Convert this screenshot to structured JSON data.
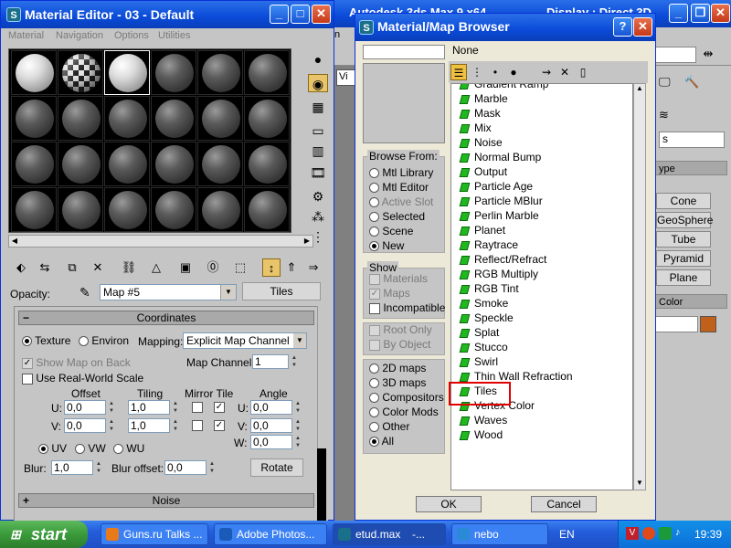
{
  "bg_window": {
    "title": "Autodesk 3ds Max 9 x64",
    "title_right": "Display : Direct 3D",
    "viewport_label": "Vi",
    "menu_fragment": "n",
    "objects": [
      "Cone",
      "GeoSphere",
      "Tube",
      "Pyramid",
      "Plane"
    ],
    "section_type": "ype",
    "section_color": "Color",
    "dropdown_frag": "s",
    "color_swatch": "#c0601a"
  },
  "material_editor": {
    "title": "Material Editor - 03 - Default",
    "menu": [
      "Material",
      "Navigation",
      "Options",
      "Utilities"
    ],
    "opacity_label": "Opacity:",
    "map_name": "Map #5",
    "map_type_button": "Tiles",
    "coordinates": {
      "header": "Coordinates",
      "texture": "Texture",
      "environ": "Environ",
      "mapping_label": "Mapping:",
      "mapping_value": "Explicit Map Channel",
      "show_map_on_back": "Show Map on Back",
      "map_channel_label": "Map Channel:",
      "map_channel_value": "1",
      "use_real_world": "Use Real-World Scale",
      "offset_label": "Offset",
      "tiling_label": "Tiling",
      "mirror_tile_label": "Mirror Tile",
      "angle_label": "Angle",
      "u_label": "U:",
      "v_label": "V:",
      "w_label": "W:",
      "u_offset": "0,0",
      "v_offset": "0,0",
      "u_tiling": "1,0",
      "v_tiling": "1,0",
      "u_angle": "0,0",
      "v_angle": "0,0",
      "w_angle": "0,0",
      "uv": "UV",
      "vw": "VW",
      "wu": "WU",
      "blur_label": "Blur:",
      "blur_value": "1,0",
      "blur_offset_label": "Blur offset:",
      "blur_offset_value": "0,0",
      "rotate_button": "Rotate"
    },
    "noise_header": "Noise"
  },
  "map_browser": {
    "title": "Material/Map Browser",
    "none_label": "None",
    "browse_from": {
      "title": "Browse From:",
      "options": [
        "Mtl Library",
        "Mtl Editor",
        "Active Slot",
        "Selected",
        "Scene",
        "New"
      ]
    },
    "show": {
      "title": "Show",
      "options": [
        "Materials",
        "Maps",
        "Incompatible"
      ]
    },
    "filters": [
      "Root Only",
      "By Object"
    ],
    "categories": [
      "2D maps",
      "3D maps",
      "Compositors",
      "Color Mods",
      "Other",
      "All"
    ],
    "list_items": [
      "Gradient Ramp",
      "Marble",
      "Mask",
      "Mix",
      "Noise",
      "Normal Bump",
      "Output",
      "Particle Age",
      "Particle MBlur",
      "Perlin Marble",
      "Planet",
      "Raytrace",
      "Reflect/Refract",
      "RGB Multiply",
      "RGB Tint",
      "Smoke",
      "Speckle",
      "Splat",
      "Stucco",
      "Swirl",
      "Thin Wall Refraction",
      "Tiles",
      "Vertex Color",
      "Waves",
      "Wood"
    ],
    "selected_item": "Tiles",
    "ok_button": "OK",
    "cancel_button": "Cancel"
  },
  "taskbar": {
    "start_label": "start",
    "tasks": [
      "Guns.ru Talks ...",
      "Adobe Photos...",
      "etud.max",
      "-...",
      "nebo"
    ],
    "language": "EN",
    "clock": "19:39"
  }
}
